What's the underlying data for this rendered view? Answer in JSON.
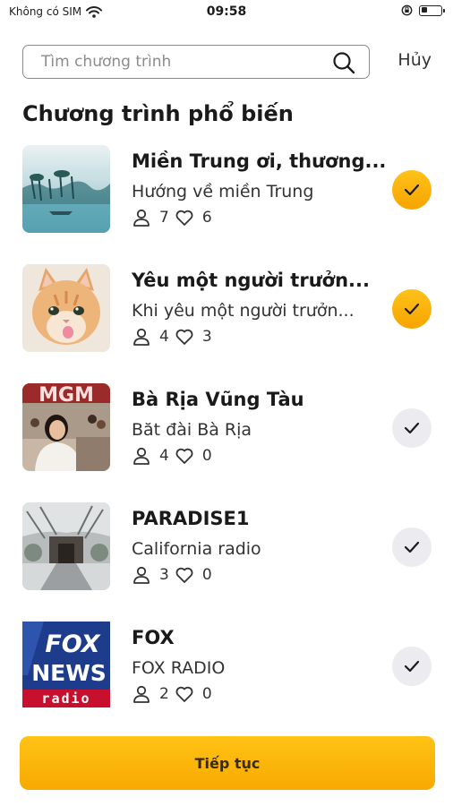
{
  "status_bar": {
    "carrier": "Không có SIM",
    "time": "09:58",
    "wifi_icon": "wifi-icon",
    "battery_icon": "battery-icon"
  },
  "search": {
    "placeholder": "Tìm chương trình",
    "value": "",
    "cancel_label": "Hủy"
  },
  "section_title": "Chương trình phổ biến",
  "programs": [
    {
      "title": "Miền Trung ơi, thương...",
      "subtitle": "Hướng về miền Trung",
      "listeners": "7",
      "likes": "6",
      "selected": true
    },
    {
      "title": "Yêu một người trưởn...",
      "subtitle": "Khi yêu một người trưởn...",
      "listeners": "4",
      "likes": "3",
      "selected": true
    },
    {
      "title": "Bà Rịa Vũng Tàu",
      "subtitle": "Băt đài Bà Rịa",
      "listeners": "4",
      "likes": "0",
      "selected": false
    },
    {
      "title": "PARADISE1",
      "subtitle": "California radio",
      "listeners": "3",
      "likes": "0",
      "selected": false
    },
    {
      "title": "FOX",
      "subtitle": "FOX RADIO",
      "listeners": "2",
      "likes": "0",
      "selected": false
    }
  ],
  "thumbnail_text": {
    "fox_line1": "FOX",
    "fox_line2": "NEWS",
    "fox_line3": "radio",
    "mgm": "MGM"
  },
  "continue_label": "Tiếp tục",
  "colors": {
    "accent": "#FFB300",
    "check_off": "#EBEBF0",
    "text": "#1C1C1C"
  }
}
